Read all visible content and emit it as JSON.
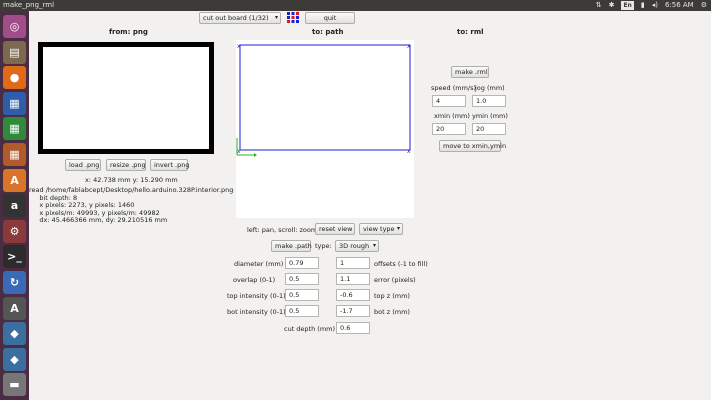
{
  "window": {
    "title": "make_png_rml",
    "tray": {
      "lang": "En",
      "time": "6:56 AM"
    }
  },
  "launcher": {
    "items": [
      {
        "name": "ubuntu-dash-icon",
        "glyph": "◎",
        "color": "#a04d8a"
      },
      {
        "name": "files-icon",
        "glyph": "▤",
        "color": "#7d6950"
      },
      {
        "name": "firefox-icon",
        "glyph": "●",
        "color": "#e06a1a"
      },
      {
        "name": "writer-icon",
        "glyph": "▦",
        "color": "#2f5da8"
      },
      {
        "name": "calc-icon",
        "glyph": "▦",
        "color": "#2f8a3a"
      },
      {
        "name": "impress-icon",
        "glyph": "▦",
        "color": "#b25a2a"
      },
      {
        "name": "software-center-icon",
        "glyph": "A",
        "color": "#d9752b"
      },
      {
        "name": "amazon-icon",
        "glyph": "a",
        "color": "#333333"
      },
      {
        "name": "settings-icon",
        "glyph": "⚙",
        "color": "#8a3a3a"
      },
      {
        "name": "terminal-icon",
        "glyph": ">_",
        "color": "#2c2c2c"
      },
      {
        "name": "update-icon",
        "glyph": "↻",
        "color": "#3a6ab5"
      },
      {
        "name": "atom-icon",
        "glyph": "A",
        "color": "#555555"
      },
      {
        "name": "python-icon",
        "glyph": "◆",
        "color": "#3b6fa0"
      },
      {
        "name": "python2-icon",
        "glyph": "◆",
        "color": "#3b6fa0"
      },
      {
        "name": "drive-icon",
        "glyph": "▬",
        "color": "#777777"
      }
    ]
  },
  "toolbar": {
    "process_select": "cut out board (1/32)",
    "quit_label": "quit"
  },
  "from_png": {
    "header": "from: png",
    "load_label": "load .png",
    "resize_label": "resize .png",
    "invert_label": "invert .png",
    "coords": "x: 42.738 mm  y: 15.290 mm",
    "info": [
      "read /home/fablabcept/Desktop/hello.arduino.328P.interior.png",
      "     bit depth: 8",
      "     x pixels: 2273, y pixels: 1460",
      "     x pixels/m: 49993, y pixels/m: 49982",
      "     dx: 45.466366 mm, dy: 29.210516 mm"
    ]
  },
  "to_path": {
    "header": "to: path",
    "hint": "left: pan, scroll: zoom",
    "reset_view_label": "reset view",
    "view_type_label": "view type",
    "make_path_label": "make .path",
    "type_label": "type:",
    "type_value": "3D rough",
    "params": {
      "diameter_label": "diameter (mm)",
      "diameter": "0.79",
      "offsets_label": "offsets (-1 to fill)",
      "offsets": "1",
      "overlap_label": "overlap (0-1)",
      "overlap": "0.5",
      "error_label": "error (pixels)",
      "error": "1.1",
      "top_intensity_label": "top intensity (0-1)",
      "top_intensity": "0.5",
      "top_z_label": "top z (mm)",
      "top_z": "-0.6",
      "bot_intensity_label": "bot intensity (0-1)",
      "bot_intensity": "0.5",
      "bot_z_label": "bot z (mm)",
      "bot_z": "-1.7",
      "cut_depth_label": "cut depth (mm)",
      "cut_depth": "0.6"
    }
  },
  "to_rml": {
    "header": "to: rml",
    "make_rml_label": "make .rml",
    "speed_label": "speed (mm/s)",
    "speed": "4",
    "jog_label": "jog (mm)",
    "jog": "1.0",
    "xmin_label": "xmin (mm)",
    "xmin": "20",
    "ymin_label": "ymin (mm)",
    "ymin": "20",
    "move_label": "move to xmin,ymin"
  },
  "colors": {
    "path_blue": "#1f1fd0",
    "axis_green": "#1fb81f",
    "topbar": "#3c3b37",
    "launcher": "#4a2d42"
  }
}
